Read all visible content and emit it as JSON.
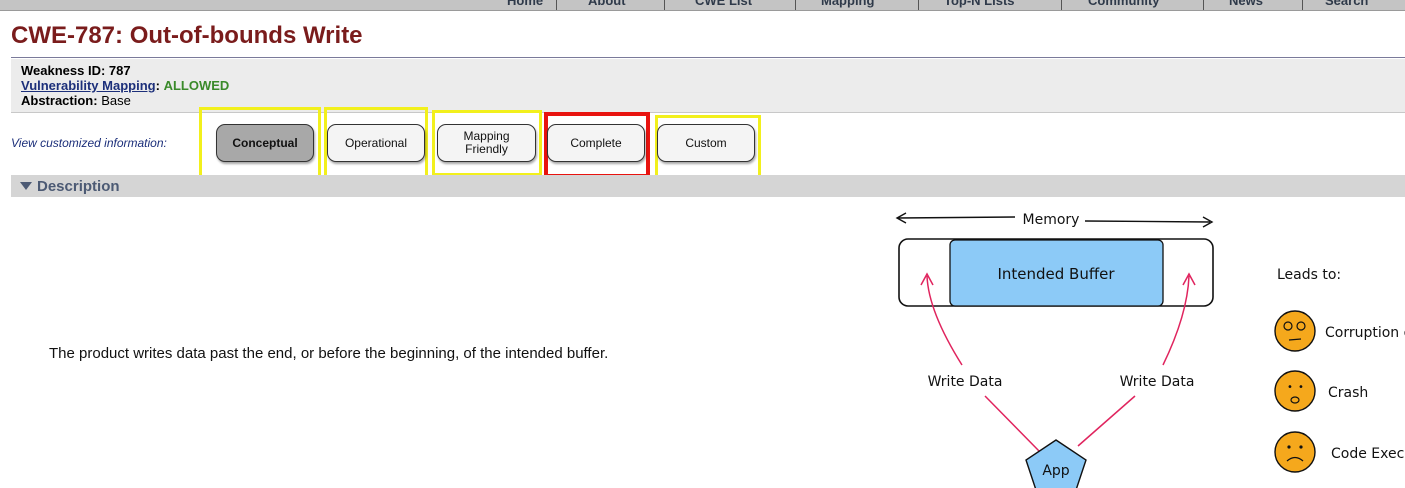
{
  "nav": {
    "items": [
      "Home",
      "About",
      "CWE List",
      "Mapping",
      "Top-N Lists",
      "Community",
      "News",
      "Search"
    ]
  },
  "title": "CWE-787: Out-of-bounds Write",
  "meta": {
    "weakness_id_label": "Weakness ID:",
    "weakness_id": "787",
    "vuln_mapping_label": "Vulnerability Mapping",
    "vuln_mapping_colon": ":",
    "vuln_mapping_value": "ALLOWED",
    "abstraction_label": "Abstraction:",
    "abstraction_value": "Base"
  },
  "views": {
    "label": "View customized information:",
    "buttons": [
      "Conceptual",
      "Operational",
      "Mapping Friendly",
      "Complete",
      "Custom"
    ],
    "active": "Conceptual",
    "highlighted_red": "Complete"
  },
  "description": {
    "header": "Description",
    "text": "The product writes data past the end, or before the beginning, of the intended buffer."
  },
  "diagram": {
    "memory_label": "Memory",
    "buffer_label": "Intended Buffer",
    "write_left": "Write Data",
    "write_right": "Write Data",
    "app_label": "App",
    "leads_to": "Leads to:",
    "consequences": [
      "Corruption o",
      "Crash",
      "Code Execu"
    ]
  },
  "colors": {
    "title": "#7a1c1c",
    "link": "#1c2f7a",
    "allowed": "#3a8a2a",
    "highlight_yellow": "#f2f01c",
    "highlight_red": "#e8130f",
    "buffer_fill": "#8ccaf7",
    "arrow": "#e0245e",
    "face": "#f5a81c"
  }
}
